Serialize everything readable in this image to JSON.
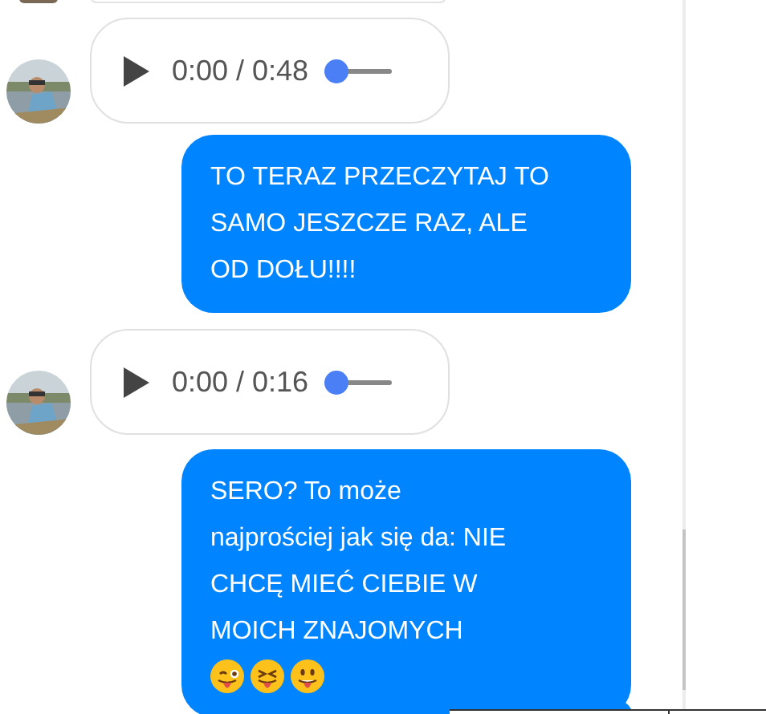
{
  "messages": [
    {
      "kind": "audio",
      "time": "0:00 / 0:48",
      "level": 0
    },
    {
      "kind": "text",
      "text": "TO TERAZ PRZECZYTAJ TO\nSAMO JESZCZE RAZ, ALE\nOD DOŁU!!!!"
    },
    {
      "kind": "audio",
      "time": "0:00 / 0:16",
      "level": 0
    },
    {
      "kind": "text",
      "text": "SERO? To może\nnajprościej jak się da: NIE\nCHCĘ MIEĆ CIEBIE W\nMOICH ZNAJOMYCH",
      "emojis": [
        {
          "kind": "wink"
        },
        {
          "kind": "squint"
        },
        {
          "kind": "grin"
        }
      ]
    }
  ]
}
